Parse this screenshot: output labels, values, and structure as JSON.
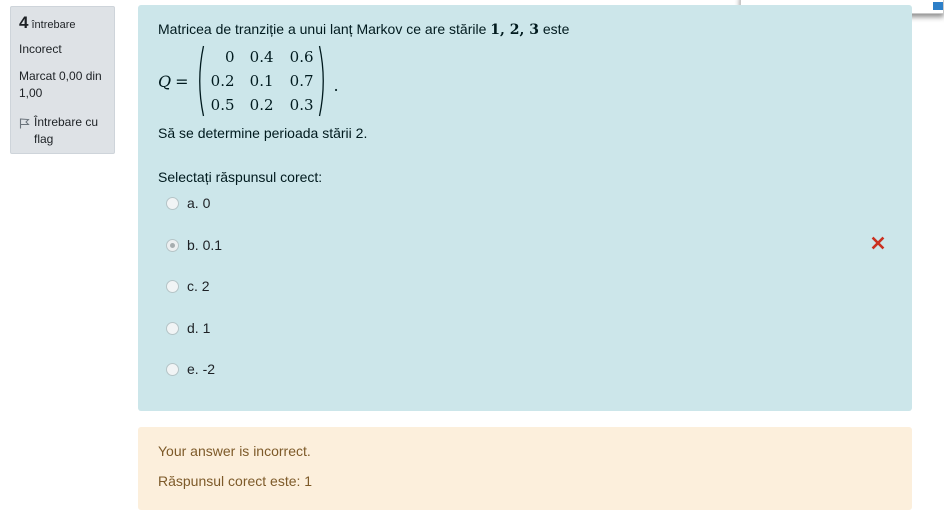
{
  "info": {
    "question_number": "4",
    "question_word": "întrebare",
    "state": "Incorect",
    "grade": "Marcat 0,00 din 1,00",
    "flag_label": "Întrebare cu flag",
    "flag_icon": "flag-outline-icon"
  },
  "question": {
    "text_prefix": "Matricea de tranziție a unui lanț Markov ce are stările ",
    "states_math": "1, 2, 3",
    "text_suffix": " este",
    "matrix_var": "Q",
    "matrix_eq": "=",
    "matrix": [
      [
        "0",
        "0.4",
        "0.6"
      ],
      [
        "0.2",
        "0.1",
        "0.7"
      ],
      [
        "0.5",
        "0.2",
        "0.3"
      ]
    ],
    "matrix_end": ".",
    "task": "Să se determine perioada stării 2.",
    "prompt": "Selectați răspunsul corect:"
  },
  "answers": [
    {
      "label": "a. 0",
      "selected": false,
      "incorrect": false
    },
    {
      "label": "b. 0.1",
      "selected": true,
      "incorrect": true
    },
    {
      "label": "c. 2",
      "selected": false,
      "incorrect": false
    },
    {
      "label": "d. 1",
      "selected": false,
      "incorrect": false
    },
    {
      "label": "e. -2",
      "selected": false,
      "incorrect": false
    }
  ],
  "feedback": {
    "general": "Your answer is incorrect.",
    "correct_answer": "Răspunsul corect este: 1"
  },
  "colors": {
    "question_bg": "#cce6ea",
    "feedback_bg": "#fcefdc",
    "info_bg": "#dee2e6",
    "incorrect_mark": "#ca3120"
  }
}
